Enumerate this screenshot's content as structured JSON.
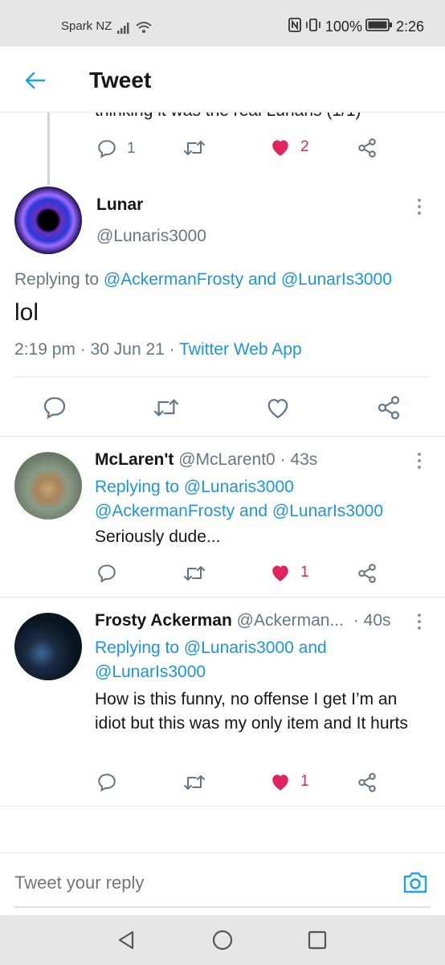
{
  "status_bar": {
    "carrier": "Spark NZ",
    "battery": "100%",
    "time": "2:26"
  },
  "header": {
    "title": "Tweet"
  },
  "previous_tweet": {
    "partial_text": "thinking it was the real Lunaris (1/1)",
    "reply_count": "1",
    "like_count": "2"
  },
  "main_tweet": {
    "name": "Lunar",
    "handle": "@Lunaris3000",
    "replying_prefix": "Replying to",
    "replying_user1": "@AckermanFrosty",
    "replying_and": "and",
    "replying_user2": "@LunarIs3000",
    "text": "lol",
    "time": "2:19 pm",
    "dot": "·",
    "date": "30 Jun 21",
    "source": "Twitter Web App"
  },
  "replies": [
    {
      "name": "McLaren't",
      "handle": "@McLarent0",
      "time": "· 43s",
      "replying_prefix": "Replying to",
      "replying_user1": "@Lunaris3000",
      "replying_user2": "@AckermanFrosty",
      "replying_and": "and",
      "replying_user3": "@LunarIs3000",
      "text": "Seriously dude...",
      "like_count": "1"
    },
    {
      "name": "Frosty Ackerman",
      "handle": "@Ackerman...",
      "time": "· 40s",
      "replying_prefix": "Replying to",
      "replying_user1": "@Lunaris3000",
      "replying_and": "and",
      "replying_user2": "@LunarIs3000",
      "text": "How is this funny, no offense I get I’m an idiot but this was my only item and It hurts",
      "like_count": "1"
    }
  ],
  "reply_bar": {
    "placeholder": "Tweet your reply"
  },
  "colors": {
    "link": "#1b95e0",
    "like": "#e0245e",
    "muted": "#657786",
    "accent": "#1da1f2"
  }
}
